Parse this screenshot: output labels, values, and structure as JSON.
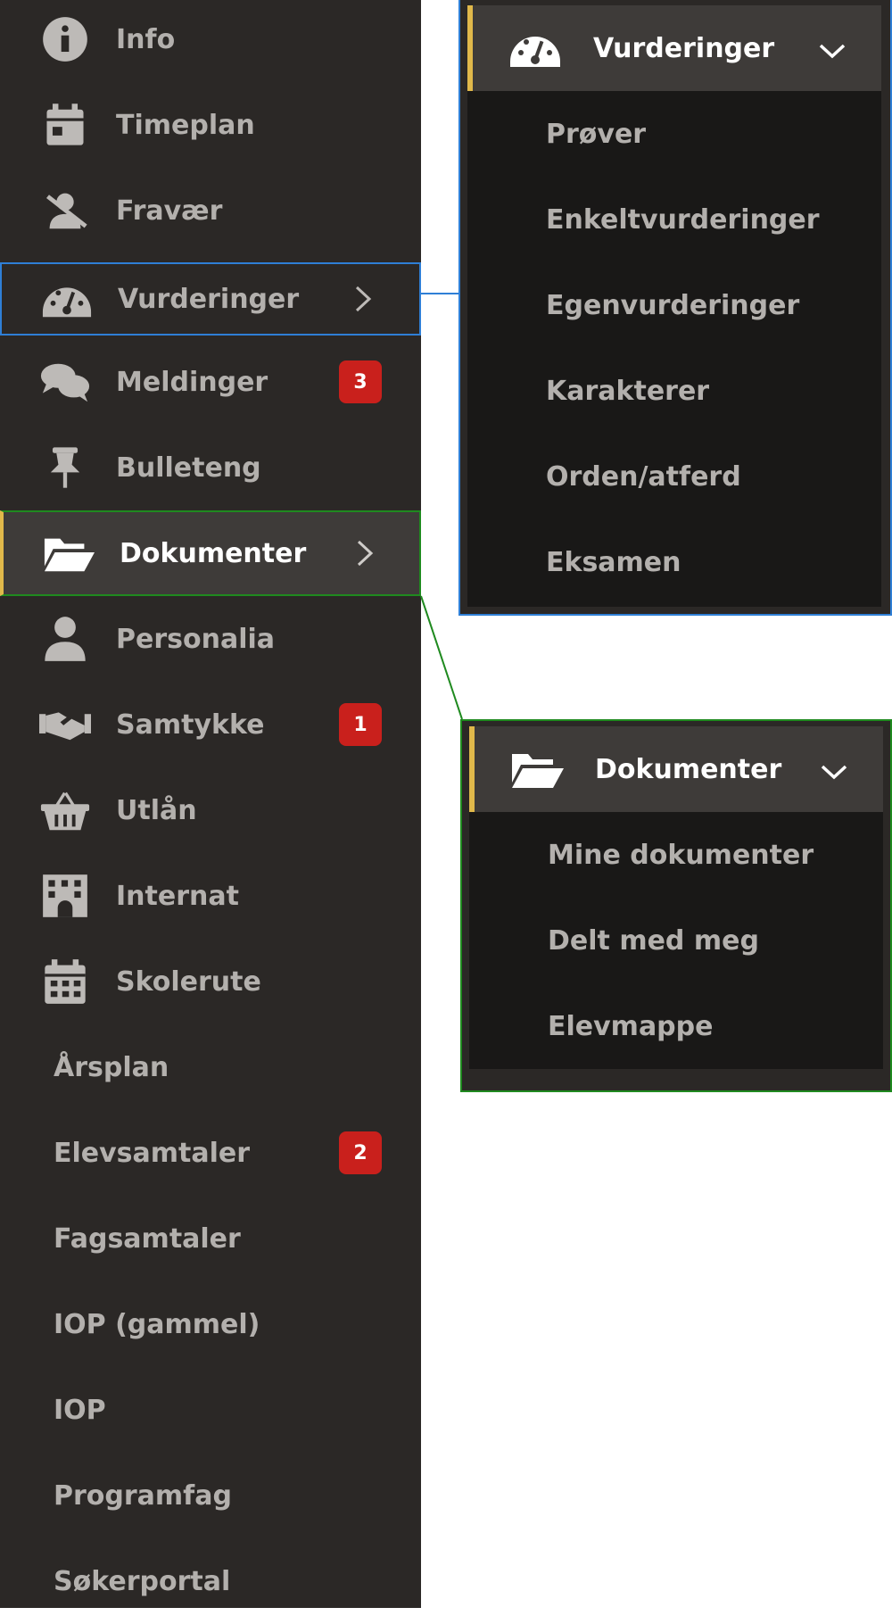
{
  "sidebar": {
    "items": [
      {
        "label": "Info"
      },
      {
        "label": "Timeplan"
      },
      {
        "label": "Fravær"
      },
      {
        "label": "Vurderinger"
      },
      {
        "label": "Meldinger",
        "badge": "3"
      },
      {
        "label": "Bulleteng"
      },
      {
        "label": "Dokumenter"
      },
      {
        "label": "Personalia"
      },
      {
        "label": "Samtykke",
        "badge": "1"
      },
      {
        "label": "Utlån"
      },
      {
        "label": "Internat"
      },
      {
        "label": "Skolerute"
      },
      {
        "label": "Årsplan"
      },
      {
        "label": "Elevsamtaler",
        "badge": "2"
      },
      {
        "label": "Fagsamtaler"
      },
      {
        "label": "IOP (gammel)"
      },
      {
        "label": "IOP"
      },
      {
        "label": "Programfag"
      },
      {
        "label": "Søkerportal"
      }
    ]
  },
  "popups": {
    "vurderinger": {
      "title": "Vurderinger",
      "items": [
        "Prøver",
        "Enkeltvurderinger",
        "Egenvurderinger",
        "Karakterer",
        "Orden/atferd",
        "Eksamen"
      ]
    },
    "dokumenter": {
      "title": "Dokumenter",
      "items": [
        "Mine dokumenter",
        "Delt med meg",
        "Elevmappe"
      ]
    }
  },
  "colors": {
    "sidebar_bg": "#2b2826",
    "active_bg": "#3e3b39",
    "submenu_bg": "#191817",
    "accent": "#e0b84a",
    "badge": "#c9201c",
    "highlight_blue": "#2f7fd6",
    "highlight_green": "#1f8a1f"
  }
}
